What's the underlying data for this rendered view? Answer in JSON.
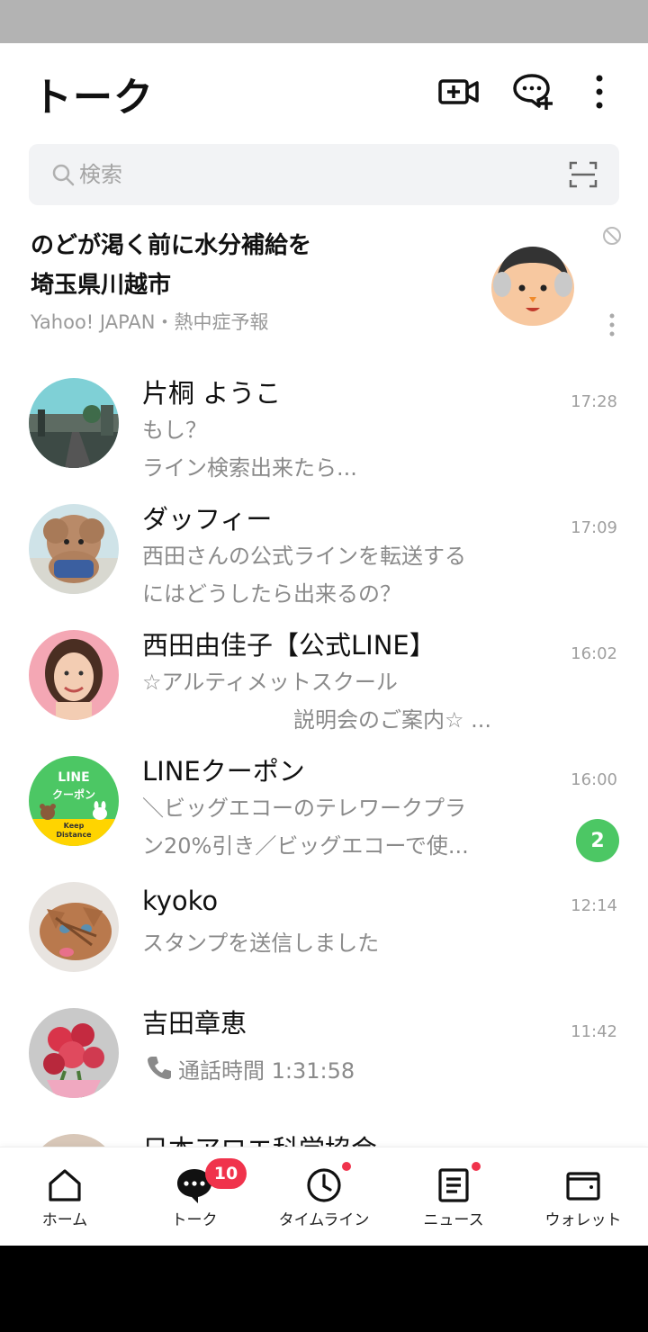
{
  "header": {
    "title": "トーク"
  },
  "search": {
    "placeholder": "検索"
  },
  "ad": {
    "title_line1": "のどが渇く前に水分補給を",
    "title_line2": "埼玉県川越市",
    "source": "Yahoo! JAPAN・熱中症予報"
  },
  "chats": [
    {
      "name": "片桐 ようこ",
      "line1": "もし？",
      "line2": "ライン検索出来たら...",
      "time": "17:28"
    },
    {
      "name": "ダッフィー",
      "line1": "西田さんの公式ラインを転送する",
      "line2": "にはどうしたら出来るの？",
      "time": "17:09"
    },
    {
      "name": "西田由佳子【公式LINE】",
      "line1": "☆アルティメットスクール",
      "line2": "説明会のご案内☆ ...",
      "time": "16:02"
    },
    {
      "name": "LINEクーポン",
      "line1": "＼ビッグエコーのテレワークプラ",
      "line2": "ン20%引き／ビッグエコーで使...",
      "time": "16:00",
      "unread": "2",
      "avatar_text1": "LINE",
      "avatar_text2": "クーポン",
      "avatar_text3": "Keep",
      "avatar_text4": "Distance"
    },
    {
      "name": "kyoko",
      "line1": "スタンプを送信しました",
      "time": "12:14"
    },
    {
      "name": "吉田章恵",
      "line1": "通話時間 1:31:58",
      "time": "11:42"
    },
    {
      "name": "日本アロエ科学協会"
    }
  ],
  "tabs": [
    {
      "label": "ホーム"
    },
    {
      "label": "トーク",
      "badge": "10"
    },
    {
      "label": "タイムライン"
    },
    {
      "label": "ニュース"
    },
    {
      "label": "ウォレット"
    }
  ],
  "colors": {
    "accent_green": "#4cc764",
    "badge_red": "#f0334c"
  }
}
